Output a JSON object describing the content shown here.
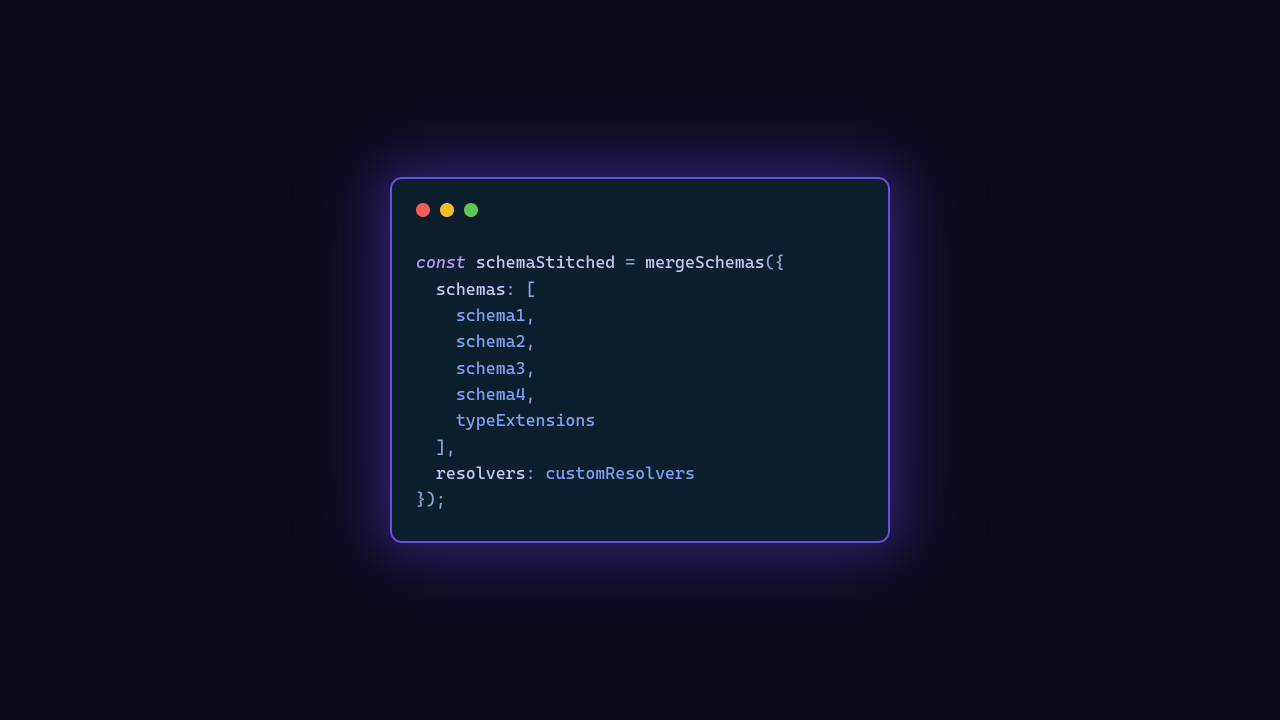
{
  "traffic_colors": {
    "red": "#ec5f59",
    "yellow": "#f4bd2f",
    "green": "#5fc454"
  },
  "code": {
    "kw_const": "const",
    "varname": "schemaStitched",
    "eq": " = ",
    "fn": "mergeSchemas",
    "open": "({",
    "prop_schemas": "schemas",
    "colon": ": ",
    "bracket_open": "[",
    "item1": "schema1",
    "item2": "schema2",
    "item3": "schema3",
    "item4": "schema4",
    "item5": "typeExtensions",
    "bracket_close": "]",
    "comma": ",",
    "prop_resolvers": "resolvers",
    "val_resolvers": "customResolvers",
    "close": "});"
  }
}
